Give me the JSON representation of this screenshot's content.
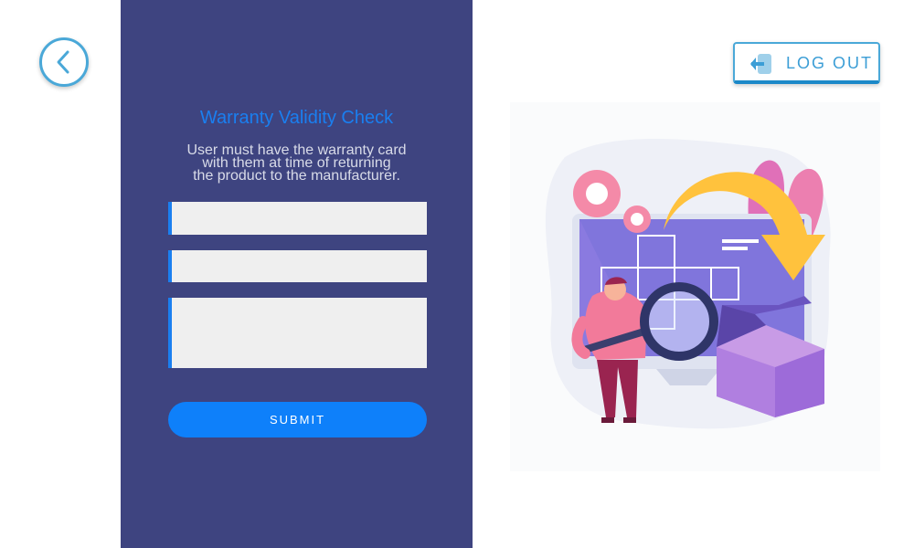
{
  "header": {
    "back_icon": "chevron-left-icon",
    "logout_label": "LOG OUT",
    "logout_icon": "sign-out-icon"
  },
  "form": {
    "title": "Warranty Validity Check",
    "description_lines": [
      "User must have the warranty card",
      "with them at  time of returning",
      "the product to the manufacturer."
    ],
    "field_1": {
      "value": "",
      "placeholder": ""
    },
    "field_2": {
      "value": "",
      "placeholder": ""
    },
    "field_3": {
      "value": "",
      "placeholder": ""
    },
    "submit_label": "SUBMIT"
  },
  "illustration": {
    "icon": "product-inspection-illustration"
  },
  "colors": {
    "panel": "#3e4480",
    "accent": "#0e80fa",
    "title": "#1a7ff0",
    "logout": "#3c9ed6"
  }
}
